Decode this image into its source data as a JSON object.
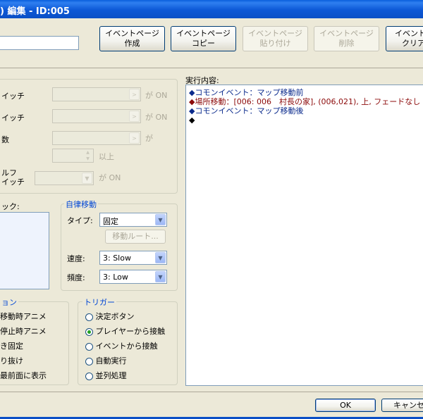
{
  "window": {
    "title": ") 編集 - ID:005"
  },
  "toolbar": {
    "buttons": [
      {
        "line1": "イベントページ",
        "line2": "作成",
        "enabled": true
      },
      {
        "line1": "イベントページ",
        "line2": "コピー",
        "enabled": true
      },
      {
        "line1": "イベントページ",
        "line2": "貼り付け",
        "enabled": false
      },
      {
        "line1": "イベントページ",
        "line2": "削除",
        "enabled": false
      },
      {
        "line1": "イベントペ",
        "line2": "クリア",
        "enabled": true
      }
    ],
    "name_value": ""
  },
  "conditions": {
    "rows": [
      {
        "label": "イッチ",
        "suffix": "が ON"
      },
      {
        "label": "イッチ",
        "suffix": "が ON"
      },
      {
        "label": "数",
        "suffix": "が"
      },
      {
        "label": "",
        "suffix": "以上"
      },
      {
        "label_line1": "ルフ",
        "label_line2": "イッチ",
        "suffix": "が ON"
      }
    ]
  },
  "graphic": {
    "label": "ック:"
  },
  "autonomous": {
    "title": "自律移動",
    "type_label": "タイプ:",
    "type_value": "固定",
    "route_button": "移動ルート...",
    "speed_label": "速度:",
    "speed_value": "3: Slow",
    "freq_label": "頻度:",
    "freq_value": "3: Low"
  },
  "options": {
    "title": "ョン",
    "items": [
      "移動時アニメ",
      "停止時アニメ",
      "き固定",
      "り抜け",
      "最前面に表示"
    ]
  },
  "trigger": {
    "title": "トリガー",
    "items": [
      "決定ボタン",
      "プレイヤーから接触",
      "イベントから接触",
      "自動実行",
      "並列処理"
    ],
    "selected": 1
  },
  "contents": {
    "label": "実行内容:",
    "commands": [
      {
        "text": "◆コモンイベント：マップ移動前",
        "color": "#0a2a8c"
      },
      {
        "text": "◆場所移動：[006: 006　村長の家], (006,021), 上, フェードなし",
        "color": "#8c0a0a"
      },
      {
        "text": "◆コモンイベント：マップ移動後",
        "color": "#0a2a8c"
      },
      {
        "text": "◆",
        "color": "#000000"
      }
    ]
  },
  "footer": {
    "ok": "OK",
    "cancel": "キャンセル"
  }
}
